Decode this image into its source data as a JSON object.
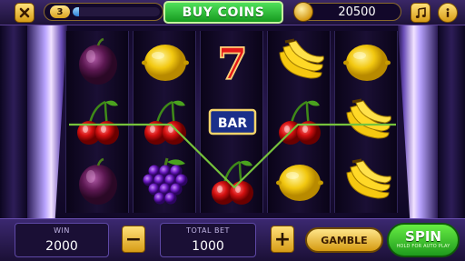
{
  "topbar": {
    "close_icon": "close-icon",
    "level": "3",
    "level_progress": 0.07,
    "buy_label": "BUY COINS",
    "coins": "20500",
    "music_icon": "music-icon",
    "info_icon": "info-icon"
  },
  "reels": [
    [
      "plum",
      "cherry",
      "plum"
    ],
    [
      "lemon",
      "cherry",
      "grapes"
    ],
    [
      "seven",
      "bar",
      "cherry"
    ],
    [
      "banana",
      "cherry",
      "lemon"
    ],
    [
      "lemon",
      "banana",
      "banana"
    ]
  ],
  "bar_text": "BAR",
  "seven_text": "7",
  "bottombar": {
    "win_label": "WIN",
    "win_value": "2000",
    "total_bet_label": "TOTAL BET",
    "total_bet_value": "1000",
    "minus_label": "−",
    "plus_label": "+",
    "gamble_label": "GAMBLE",
    "spin_label": "SPIN",
    "spin_sub": "HOLD FOR AUTO PLAY"
  },
  "colors": {
    "payline": "#76c23c",
    "accent_gold": "#e0a82a",
    "accent_green": "#2cb52a"
  }
}
